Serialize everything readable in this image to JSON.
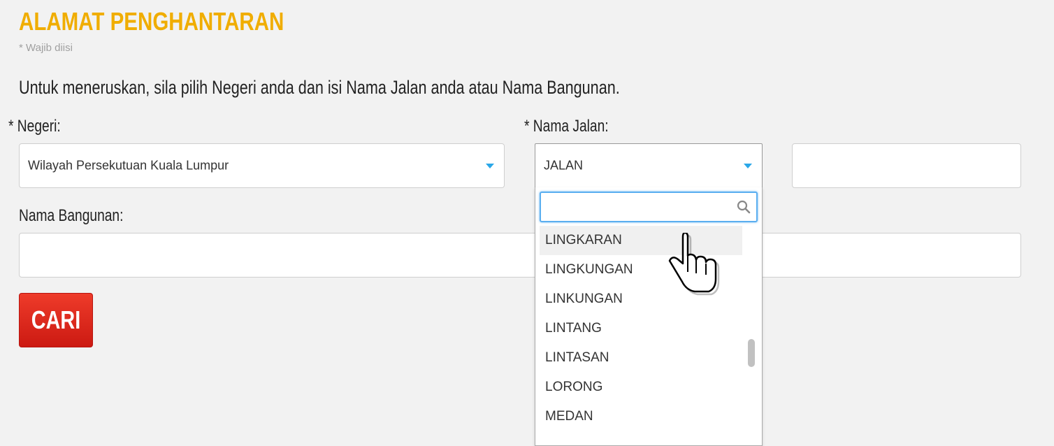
{
  "header": {
    "title": "ALAMAT PENGHANTARAN",
    "required_note": "* Wajib diisi",
    "instruction": "Untuk meneruskan, sila pilih Negeri anda dan isi Nama Jalan anda atau Nama Bangunan."
  },
  "form": {
    "negeri_label": "* Negeri:",
    "negeri_value": "Wilayah Persekutuan Kuala Lumpur",
    "jalan_label": "* Nama Jalan:",
    "jalan_type_value": "JALAN",
    "jalan_name_value": "",
    "bangunan_label": "Nama Bangunan:",
    "bangunan_value": "",
    "search_button": "CARI"
  },
  "dropdown": {
    "search_value": "",
    "options": [
      "LINGKARAN",
      "LINGKUNGAN",
      "LINKUNGAN",
      "LINTANG",
      "LINTASAN",
      "LORONG",
      "MEDAN"
    ],
    "highlighted": "LINGKARAN"
  },
  "colors": {
    "title": "#f0ad00",
    "button": "#dd2a1c",
    "caret": "#2aa7e8",
    "focus": "#5aaef0"
  },
  "icons": [
    "chevron-down-icon",
    "search-icon",
    "hand-pointer-icon"
  ]
}
